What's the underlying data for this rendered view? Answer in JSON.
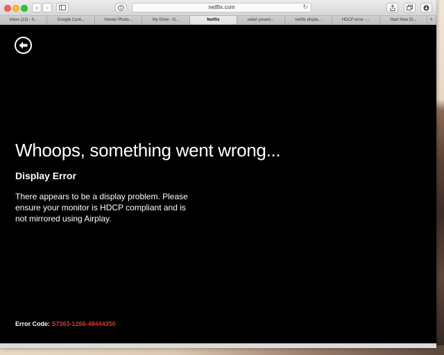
{
  "browser": {
    "url": "netflix.com",
    "tabs": [
      {
        "label": "Inbox (13) - h..."
      },
      {
        "label": "Google Cont..."
      },
      {
        "label": "Hunter Photo..."
      },
      {
        "label": "My Drive - G..."
      },
      {
        "label": "Netflix",
        "active": true
      },
      {
        "label": "safari yosem..."
      },
      {
        "label": "netflix displa..."
      },
      {
        "label": "HDCP error -..."
      },
      {
        "label": "Start New Di..."
      }
    ],
    "new_tab_label": "+",
    "reload_icon": "↻"
  },
  "page": {
    "headline": "Whoops, something went wrong...",
    "subhead": "Display Error",
    "message": "There appears to be a display problem. Please ensure your monitor is HDCP compliant and is not mirrored using Airplay.",
    "error_label": "Error Code:",
    "error_code": "S7363-1266-48444350",
    "error_code_color": "#d63a2b"
  }
}
